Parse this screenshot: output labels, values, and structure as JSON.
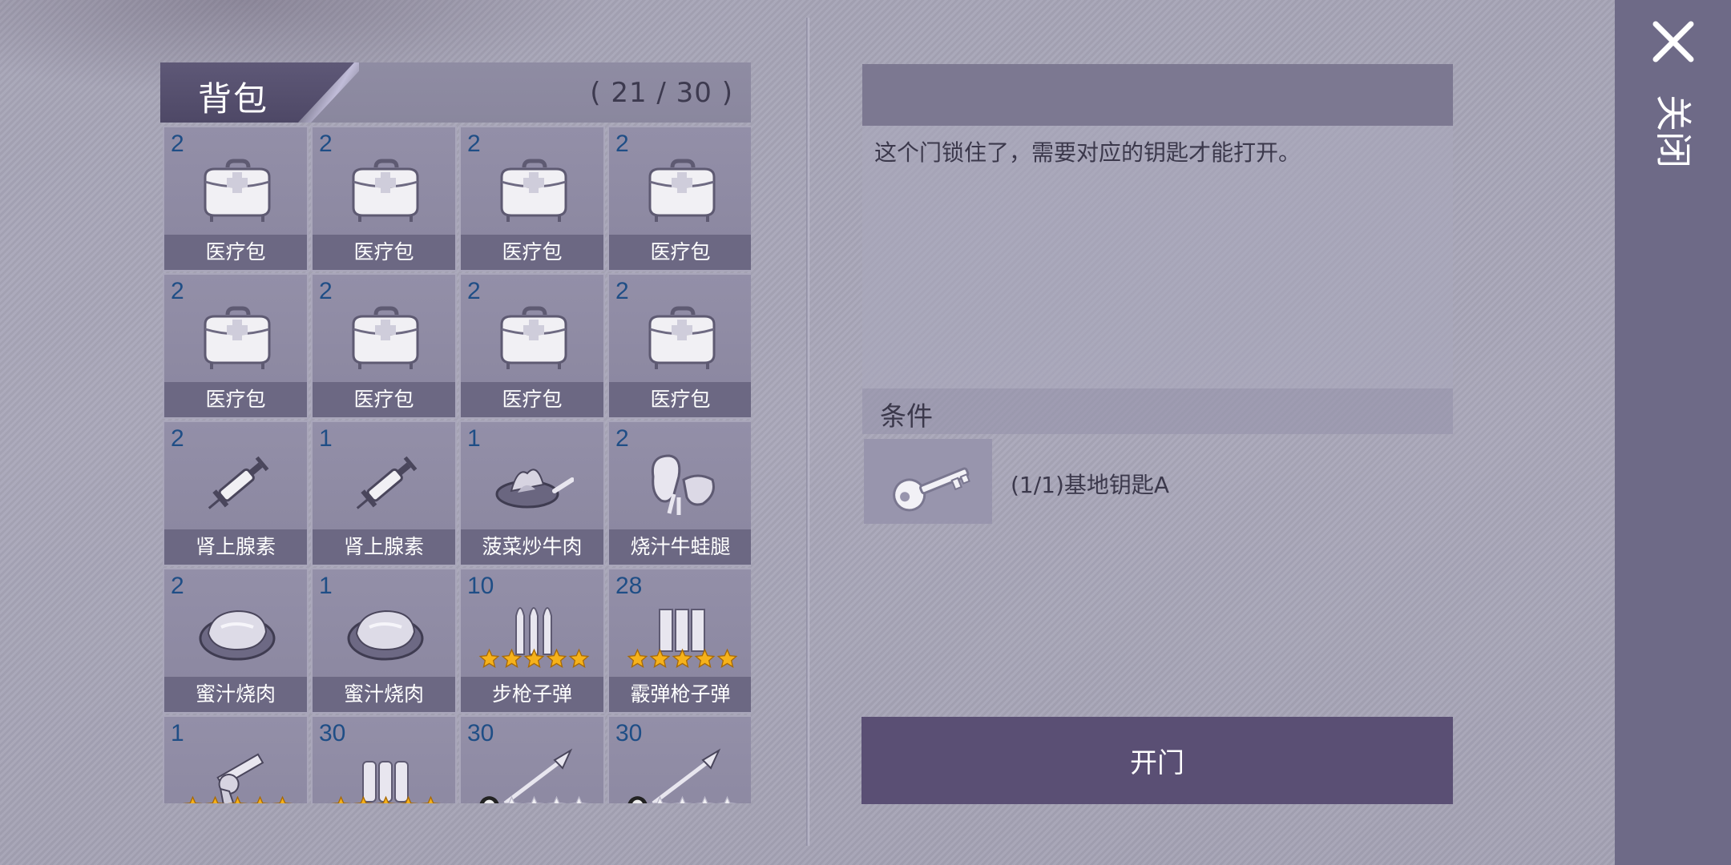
{
  "inventory": {
    "title": "背包",
    "count": "( 21 / 30 )",
    "items": [
      {
        "qty": "2",
        "label": "医疗包",
        "icon": "medkit-icon"
      },
      {
        "qty": "2",
        "label": "医疗包",
        "icon": "medkit-icon"
      },
      {
        "qty": "2",
        "label": "医疗包",
        "icon": "medkit-icon"
      },
      {
        "qty": "2",
        "label": "医疗包",
        "icon": "medkit-icon"
      },
      {
        "qty": "2",
        "label": "医疗包",
        "icon": "medkit-icon"
      },
      {
        "qty": "2",
        "label": "医疗包",
        "icon": "medkit-icon"
      },
      {
        "qty": "2",
        "label": "医疗包",
        "icon": "medkit-icon"
      },
      {
        "qty": "2",
        "label": "医疗包",
        "icon": "medkit-icon"
      },
      {
        "qty": "2",
        "label": "肾上腺素",
        "icon": "syringe-icon"
      },
      {
        "qty": "1",
        "label": "肾上腺素",
        "icon": "syringe-icon"
      },
      {
        "qty": "1",
        "label": "菠菜炒牛肉",
        "icon": "pan-dish-icon"
      },
      {
        "qty": "2",
        "label": "烧汁牛蛙腿",
        "icon": "frog-legs-icon"
      },
      {
        "qty": "2",
        "label": "蜜汁烧肉",
        "icon": "roast-meat-icon"
      },
      {
        "qty": "1",
        "label": "蜜汁烧肉",
        "icon": "roast-meat-icon"
      },
      {
        "qty": "10",
        "label": "步枪子弹",
        "icon": "rifle-ammo-icon",
        "stars": 5
      },
      {
        "qty": "28",
        "label": "霰弹枪子弹",
        "icon": "shotgun-ammo-icon",
        "stars": 5
      },
      {
        "qty": "1",
        "label": "",
        "icon": "revolver-icon",
        "stars": 5
      },
      {
        "qty": "30",
        "label": "",
        "icon": "ammo-icon",
        "stars": 5
      },
      {
        "qty": "30",
        "label": "",
        "icon": "spear-icon",
        "stars": 3,
        "skull": true
      },
      {
        "qty": "30",
        "label": "",
        "icon": "spear-icon",
        "stars": 3,
        "skull": true
      }
    ]
  },
  "detail": {
    "description": "这个门锁住了，需要对应的钥匙才能打开。",
    "conditions_title": "条件",
    "condition_text": "(1/1)基地钥匙A",
    "condition_icon": "key-icon",
    "action_label": "开门"
  },
  "close": {
    "label": "关闭"
  },
  "colors": {
    "qty_text": "#1f4e86",
    "star_gold": "#f6b21a",
    "button_bg": "#5a4f74"
  }
}
